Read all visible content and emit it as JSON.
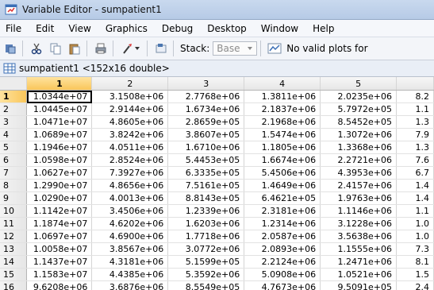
{
  "window": {
    "title": "Variable Editor - sumpatient1"
  },
  "menu": [
    "File",
    "Edit",
    "View",
    "Graphics",
    "Debug",
    "Desktop",
    "Window",
    "Help"
  ],
  "toolbar": {
    "stack_label": "Stack:",
    "stack_value": "Base",
    "plots_label": "No valid plots for"
  },
  "variable_tab": {
    "label": "sumpatient1 <152x16 double>"
  },
  "grid": {
    "columns": [
      "1",
      "2",
      "3",
      "4",
      "5",
      ""
    ],
    "rows": [
      {
        "n": "1",
        "c": [
          "1.0344e+07",
          "3.1508e+06",
          "2.7768e+06",
          "1.3811e+06",
          "2.0235e+06",
          "8.2"
        ]
      },
      {
        "n": "2",
        "c": [
          "1.0445e+07",
          "2.9144e+06",
          "1.6734e+06",
          "2.1837e+06",
          "5.7972e+05",
          "1.1"
        ]
      },
      {
        "n": "3",
        "c": [
          "1.0471e+07",
          "4.8605e+06",
          "2.8659e+05",
          "2.1968e+06",
          "8.5452e+05",
          "1.3"
        ]
      },
      {
        "n": "4",
        "c": [
          "1.0689e+07",
          "3.8242e+06",
          "3.8607e+05",
          "1.5474e+06",
          "1.3072e+06",
          "7.9"
        ]
      },
      {
        "n": "5",
        "c": [
          "1.1946e+07",
          "4.0511e+06",
          "1.6710e+06",
          "1.1805e+06",
          "1.3368e+06",
          "1.3"
        ]
      },
      {
        "n": "6",
        "c": [
          "1.0598e+07",
          "2.8524e+06",
          "5.4453e+05",
          "1.6674e+06",
          "2.2721e+06",
          "7.6"
        ]
      },
      {
        "n": "7",
        "c": [
          "1.0627e+07",
          "7.3927e+06",
          "6.3335e+05",
          "5.4506e+06",
          "4.3953e+06",
          "6.7"
        ]
      },
      {
        "n": "8",
        "c": [
          "1.2990e+07",
          "4.8656e+06",
          "7.5161e+05",
          "1.4649e+06",
          "2.4157e+06",
          "1.4"
        ]
      },
      {
        "n": "9",
        "c": [
          "1.0290e+07",
          "4.0013e+06",
          "8.8143e+05",
          "6.4621e+05",
          "1.9763e+06",
          "1.4"
        ]
      },
      {
        "n": "10",
        "c": [
          "1.1142e+07",
          "3.4506e+06",
          "1.2339e+06",
          "2.3181e+06",
          "1.1146e+06",
          "1.1"
        ]
      },
      {
        "n": "11",
        "c": [
          "1.1874e+07",
          "4.6202e+06",
          "1.6203e+06",
          "1.2314e+06",
          "3.1228e+06",
          "1.0"
        ]
      },
      {
        "n": "12",
        "c": [
          "1.0697e+07",
          "4.6900e+06",
          "1.7718e+06",
          "2.0587e+06",
          "3.5638e+06",
          "1.0"
        ]
      },
      {
        "n": "13",
        "c": [
          "1.0058e+07",
          "3.8567e+06",
          "3.0772e+06",
          "2.0893e+06",
          "1.1555e+06",
          "7.3"
        ]
      },
      {
        "n": "14",
        "c": [
          "1.1437e+07",
          "4.3181e+06",
          "5.1599e+05",
          "2.2124e+06",
          "1.2471e+06",
          "8.1"
        ]
      },
      {
        "n": "15",
        "c": [
          "1.1583e+07",
          "4.4385e+06",
          "5.3592e+06",
          "5.0908e+06",
          "1.0521e+06",
          "1.5"
        ]
      },
      {
        "n": "16",
        "c": [
          "9.6208e+06",
          "3.6876e+06",
          "8.5549e+05",
          "4.7673e+06",
          "9.5091e+05",
          "2.4"
        ]
      }
    ]
  }
}
